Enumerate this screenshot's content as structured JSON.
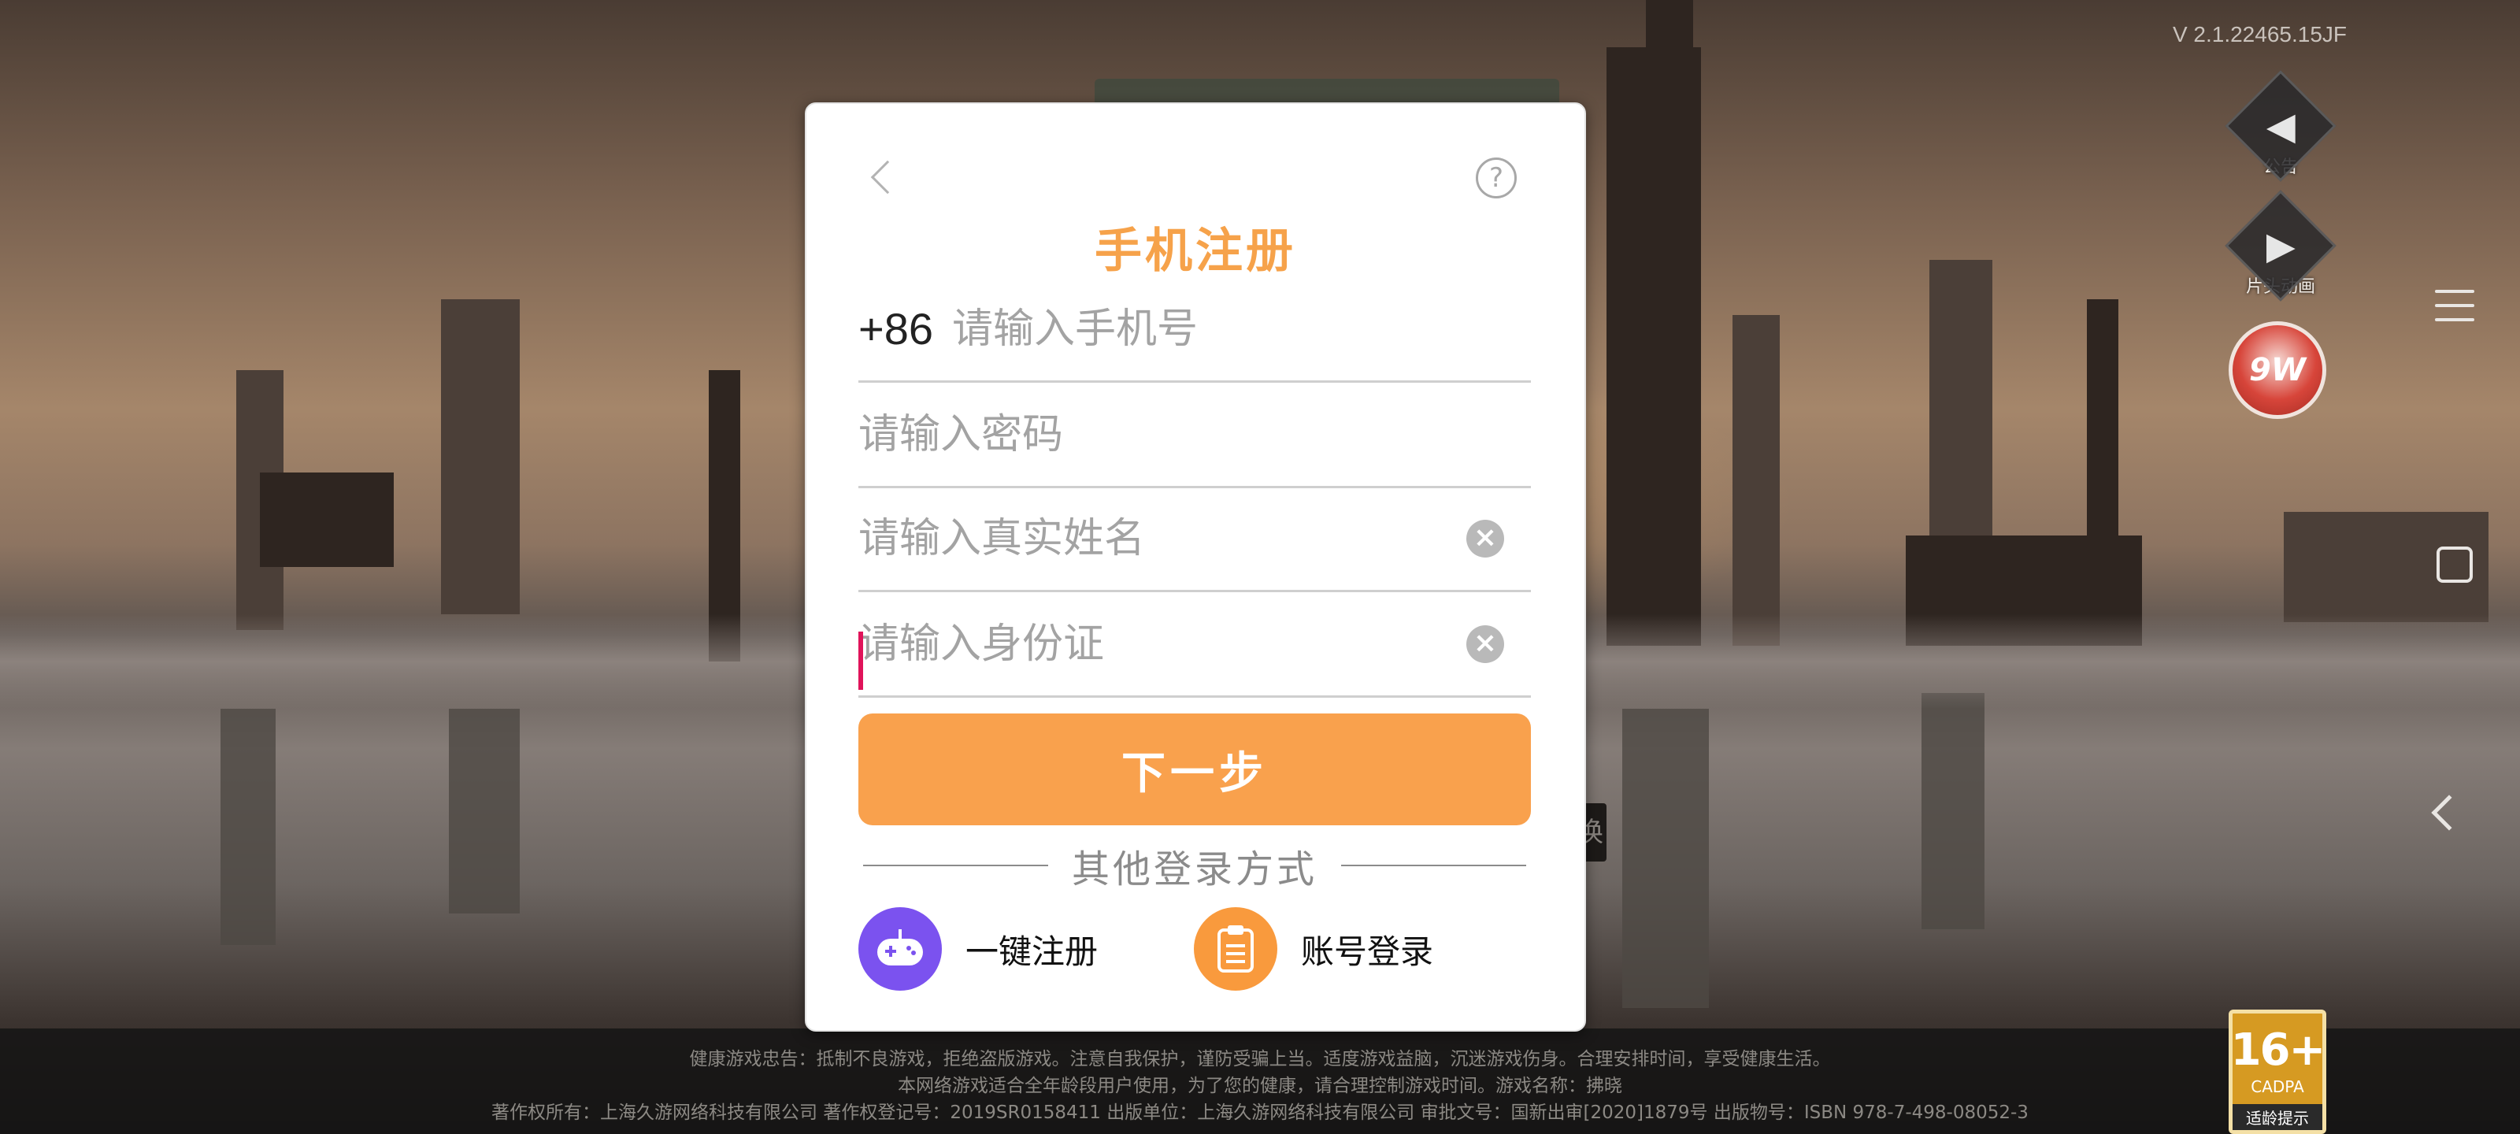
{
  "version": "V 2.1.22465.15JF",
  "side_buttons": {
    "notice_label": "公告",
    "notice_icon": "speaker-icon",
    "anim_label": "片头动画",
    "anim_icon": "play-icon",
    "brand_badge": "9W"
  },
  "modal": {
    "title": "手机注册",
    "country_code": "+86",
    "phone_placeholder": "请输入手机号",
    "password_placeholder": "请输入密码",
    "name_placeholder": "请输入真实姓名",
    "id_placeholder": "请输入身份证",
    "next_label": "下一步",
    "other_methods": "其他登录方式",
    "one_click_label": "一键注册",
    "account_login_label": "账号登录",
    "help_symbol": "?",
    "clear_symbol": "×"
  },
  "background_fragment": "换",
  "footer": {
    "line1": "健康游戏忠告：抵制不良游戏，拒绝盗版游戏。注意自我保护，谨防受骗上当。适度游戏益脑，沉迷游戏伤身。合理安排时间，享受健康生活。",
    "line2": "本网络游戏适合全年龄段用户使用，为了您的健康，请合理控制游戏时间。游戏名称：拂晓",
    "line3": "著作权所有：上海久游网络科技有限公司 著作权登记号：2019SR0158411 出版单位：上海久游网络科技有限公司 审批文号：国新出审[2020]1879号 出版物号：ISBN 978-7-498-08052-3"
  },
  "age_rating": {
    "number": "16+",
    "org": "CADPA",
    "tip": "适龄提示"
  },
  "colors": {
    "accent": "#f9a14d",
    "title": "#f6a24a",
    "one_click_icon": "#7b52ef",
    "account_icon": "#f99a3d"
  }
}
